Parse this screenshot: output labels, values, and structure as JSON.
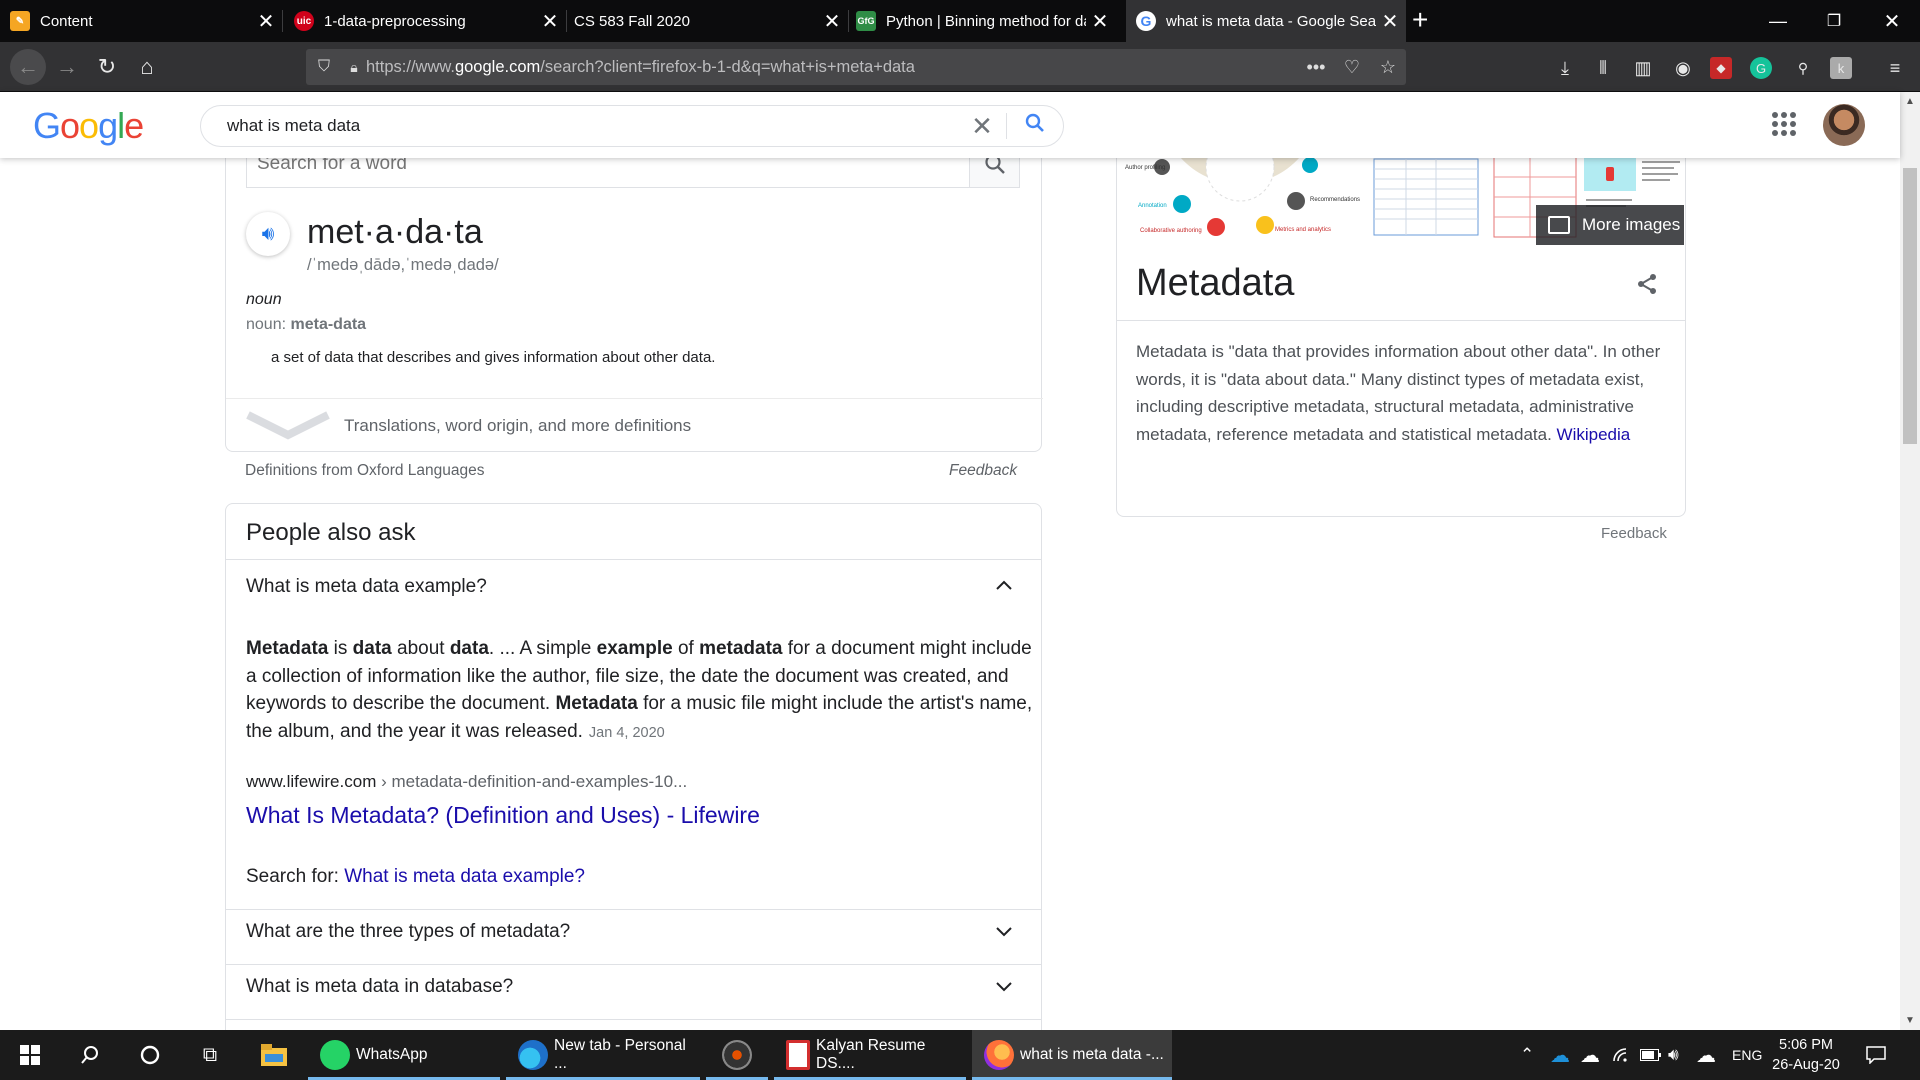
{
  "browser": {
    "tabs": [
      {
        "title": "Content",
        "favicon_color": "#f5a623"
      },
      {
        "title": "1-data-preprocessing",
        "favicon_color": "#d0021b",
        "favicon_text": "uic"
      },
      {
        "title": "CS 583 Fall 2020",
        "favicon_color": "#0c0c0d"
      },
      {
        "title": "Python | Binning method for da",
        "favicon_color": "#2f8d46",
        "favicon_text": "GfG"
      },
      {
        "title": "what is meta data - Google Sea",
        "favicon_color": "#4285f4"
      }
    ],
    "url_prefix": "https://www.",
    "url_domain": "google.com",
    "url_rest": "/search?client=firefox-b-1-d&q=what+is+meta+data"
  },
  "google": {
    "logo": "Google",
    "query": "what is meta data",
    "colors": {
      "blue": "#4285f4",
      "red": "#ea4335",
      "yellow": "#fbbc05",
      "green": "#34a853",
      "link": "#1a0dab"
    }
  },
  "dictionary": {
    "search_placeholder": "Search for a word",
    "headword": "met·a·da·ta",
    "pronunciation": "/ˈmedəˌdādə,ˈmedəˌdadə/",
    "part_of_speech": "noun",
    "form_prefix": "noun: ",
    "form_word": "meta-data",
    "definition": "a set of data that describes and gives information about other data.",
    "more_label": "Translations, word origin, and more definitions",
    "source": "Definitions from Oxford Languages",
    "feedback": "Feedback"
  },
  "people_also_ask": {
    "title": "People also ask",
    "questions": [
      "What is meta data example?",
      "What are the three types of metadata?",
      "What is meta data in database?"
    ],
    "answer_html": "<b>Metadata</b> is <b>data</b> about <b>data</b>. ... A simple <b>example</b> of <b>metadata</b> for a document might include a collection of information like the author, file size, the date the document was created, and keywords to describe the document. <b>Metadata</b> for a music file might include the artist's name, the album, and the year it was released.",
    "answer_date": "Jan 4, 2020",
    "cite_domain": "www.lifewire.com",
    "cite_path": " › metadata-definition-and-examples-10...",
    "result_title": "What Is Metadata? (Definition and Uses) - Lifewire",
    "search_for_label": "Search for: ",
    "search_for_link": "What is meta data example?"
  },
  "knowledge_panel": {
    "more_images": "More images",
    "title": "Metadata",
    "description": "Metadata is \"data that provides information about other data\". In other words, it is \"data about data.\" Many distinct types of metadata exist, including descriptive metadata, structural metadata, administrative metadata, reference metadata and statistical metadata.",
    "wiki_link": "Wikipedia",
    "feedback": "Feedback"
  },
  "taskbar": {
    "apps": [
      {
        "label": "WhatsApp",
        "color": "#25d366"
      },
      {
        "label": "New tab - Personal ...",
        "color": "#1e90d8"
      },
      {
        "label": "",
        "color": "#555555"
      },
      {
        "label": "Kalyan Resume DS....",
        "color": "#d32f2f"
      },
      {
        "label": "what is meta data -...",
        "color": "#ff7139"
      }
    ],
    "language": "ENG",
    "time": "5:06 PM",
    "date": "26-Aug-20"
  }
}
